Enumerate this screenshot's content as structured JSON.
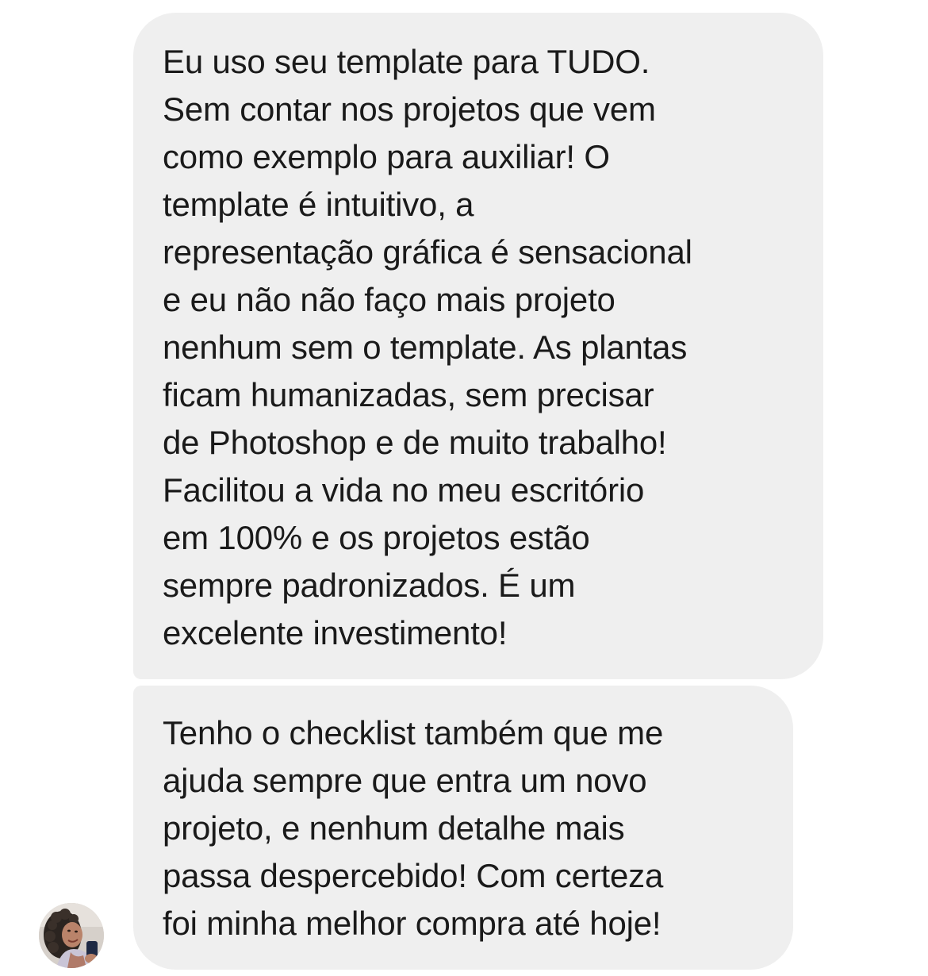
{
  "messages": [
    {
      "lines": [
        "Eu uso seu template para TUDO.",
        "Sem contar nos projetos que vem",
        "como exemplo para auxiliar! O",
        "template é intuitivo, a",
        "representação gráfica é sensacional",
        "e eu não não faço mais projeto",
        "nenhum sem o template. As plantas",
        "ficam humanizadas, sem precisar",
        "de Photoshop e de muito trabalho!",
        "Facilitou a vida no meu escritório",
        "em 100% e os projetos estão",
        "sempre padronizados. É um",
        "excelente investimento!"
      ]
    },
    {
      "lines": [
        "Tenho o checklist também que me",
        "ajuda sempre que entra um novo",
        "projeto, e nenhum detalhe mais",
        "passa despercebido! Com certeza",
        "foi minha melhor compra até hoje!"
      ]
    }
  ],
  "avatar": {
    "icon": "user-avatar-photo"
  },
  "colors": {
    "bubble_background": "#efefef",
    "text": "#1a1a1a",
    "page_background": "#ffffff"
  }
}
